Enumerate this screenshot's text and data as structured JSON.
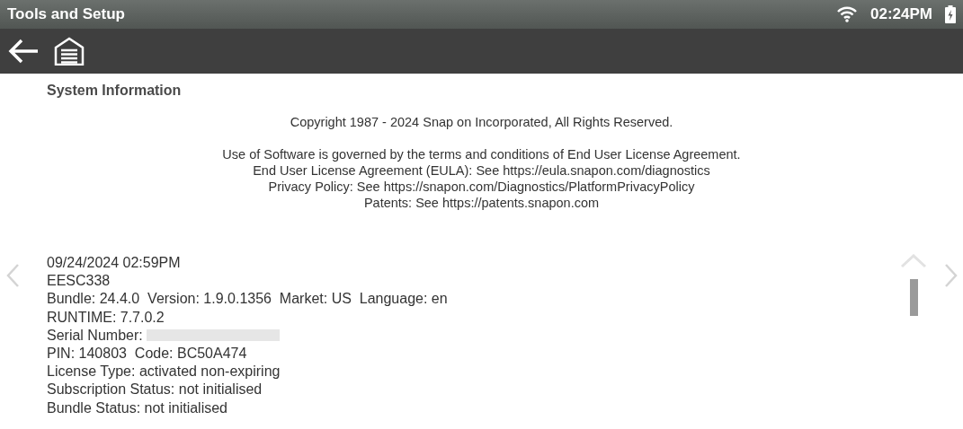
{
  "status_bar": {
    "title": "Tools and Setup",
    "time": "02:24PM"
  },
  "page_title": "System Information",
  "copyright": "Copyright 1987 - 2024 Snap on Incorporated, All Rights Reserved.",
  "legal_lines": [
    "Use of Software is governed by the terms and conditions of End User License Agreement.",
    "End User License Agreement (EULA): See https://eula.snapon.com/diagnostics",
    "Privacy Policy: See https://snapon.com/Diagnostics/PlatformPrivacyPolicy",
    "Patents: See https://patents.snapon.com"
  ],
  "info_lines": [
    {
      "kind": "text",
      "text": "09/24/2024 02:59PM"
    },
    {
      "kind": "text",
      "text": "EESC338"
    },
    {
      "kind": "text",
      "text": "Bundle: 24.4.0  Version: 1.9.0.1356  Market: US  Language: en"
    },
    {
      "kind": "text",
      "text": "RUNTIME: 7.7.0.2"
    },
    {
      "kind": "redacted",
      "text": "Serial Number:"
    },
    {
      "kind": "text",
      "text": "PIN: 140803  Code: BC50A474"
    },
    {
      "kind": "text",
      "text": "License Type: activated non-expiring"
    },
    {
      "kind": "text",
      "text": "Subscription Status: not initialised"
    },
    {
      "kind": "text",
      "text": "Bundle Status: not initialised"
    }
  ]
}
